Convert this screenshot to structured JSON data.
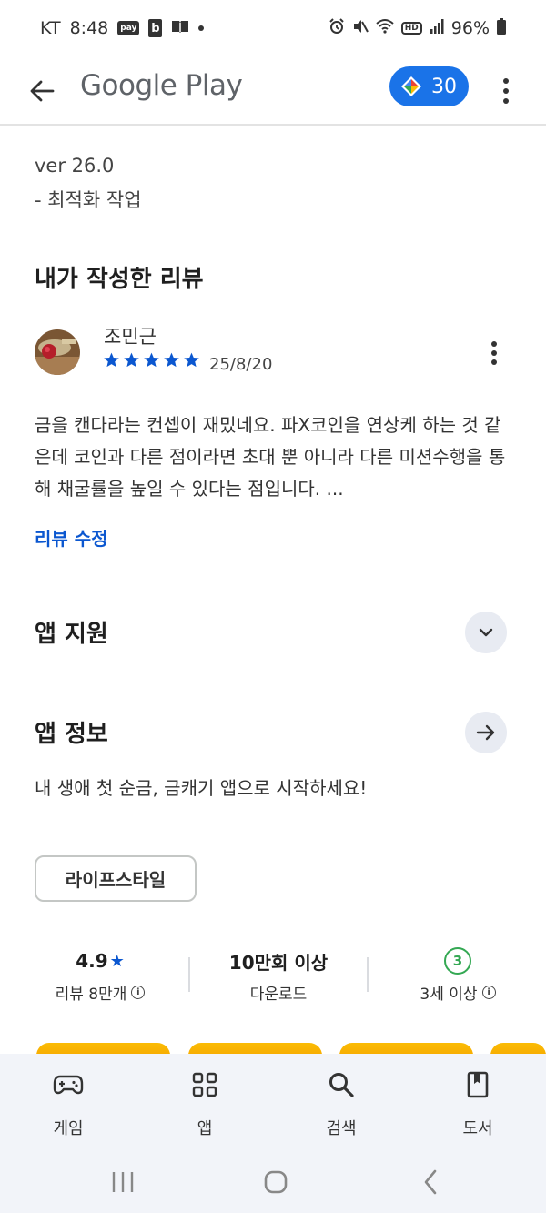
{
  "status_bar": {
    "carrier": "KT",
    "time": "8:48",
    "pay_label": "pay",
    "b_label": "b",
    "hd_label": "HD",
    "battery": "96%"
  },
  "app_bar": {
    "title": "Google Play",
    "points": "30"
  },
  "whats_new": {
    "version": "ver 26.0",
    "note": "- 최적화 작업"
  },
  "my_review": {
    "heading": "내가 작성한 리뷰",
    "reviewer": "조민근",
    "rating": 5,
    "date": "25/8/20",
    "text": "금을 캔다라는 컨셉이 재밌네요. 파X코인을 연상케 하는 것 같은데 코인과 다른 점이라면 초대 뿐 아니라 다른 미션수행을 통해 채굴률을 높일 수 있다는 점입니다. ...",
    "edit_label": "리뷰 수정"
  },
  "app_support": {
    "title": "앱 지원"
  },
  "app_info": {
    "title": "앱 정보",
    "description": "내 생애 첫 순금, 금캐기 앱으로 시작하세요!",
    "category": "라이프스타일"
  },
  "stats": {
    "rating": "4.9",
    "rating_star": "★",
    "reviews": "리뷰 8만개",
    "downloads": "10만회 이상",
    "downloads_label": "다운로드",
    "age_rating": "3",
    "age_label": "3세 이상"
  },
  "bottom_nav": {
    "items": [
      {
        "label": "게임",
        "icon": "gamepad-icon"
      },
      {
        "label": "앱",
        "icon": "apps-grid-icon"
      },
      {
        "label": "검색",
        "icon": "search-icon"
      },
      {
        "label": "도서",
        "icon": "book-icon"
      }
    ]
  },
  "colors": {
    "accent": "#0b57d0",
    "points_bg": "#1a73e8",
    "star": "#0b57d0",
    "age_green": "#34a853",
    "nav_bg": "#f2f4f9"
  }
}
